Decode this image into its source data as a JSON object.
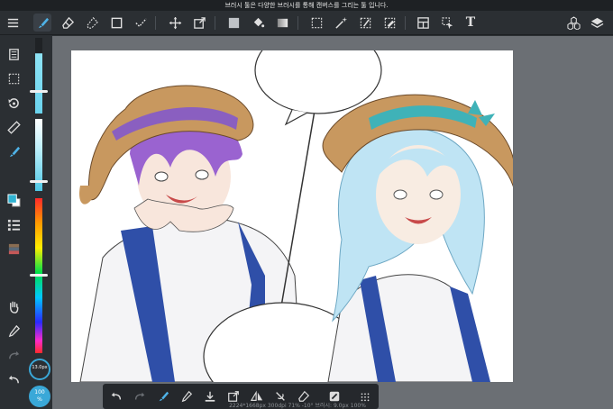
{
  "tip_text": "브러시 툴은 다양한 브러시를 통해 캔버스를 그리는 툴 입니다.",
  "toolbar": {
    "icons": [
      "menu-icon",
      "brush-icon",
      "eraser-icon",
      "blur-eraser-icon",
      "select-rect-icon",
      "line-brush-icon",
      "move-icon",
      "transform-icon",
      "fill-color-icon",
      "bucket-icon",
      "gradient-icon",
      "lasso-select-icon",
      "magic-wand-icon",
      "selection-pen-icon",
      "selection-eraser-icon",
      "frame-divider-icon",
      "select-layer-icon",
      "text-icon",
      "materials-icon",
      "layers-icon"
    ],
    "text_tool_label": "T"
  },
  "left_tools": [
    "pages-icon",
    "selection-icon",
    "undo-history-icon",
    "ruler-icon",
    "brush-panel-icon",
    "color-swatch-icon",
    "layer-list-icon",
    "color-palette-icon",
    "hand-icon",
    "eyedropper-icon",
    "redo-icon",
    "undo-icon"
  ],
  "brush_size": "13.0px",
  "zoom_label_line1": "100",
  "zoom_label_line2": "%",
  "bottom_tools": [
    "undo-icon",
    "redo-icon",
    "brush-settings-icon",
    "eyedropper-icon",
    "import-icon",
    "transform-icon",
    "flip-horizontal-icon",
    "snap-off-icon",
    "clear-icon",
    "fill-icon",
    "more-icon"
  ],
  "status_text": "2224*1668px 300dpi 71% -10° 브러시: 9.0px 100%",
  "colors": {
    "accent": "#3aa8d8",
    "primary_color": "#30b3d2"
  }
}
